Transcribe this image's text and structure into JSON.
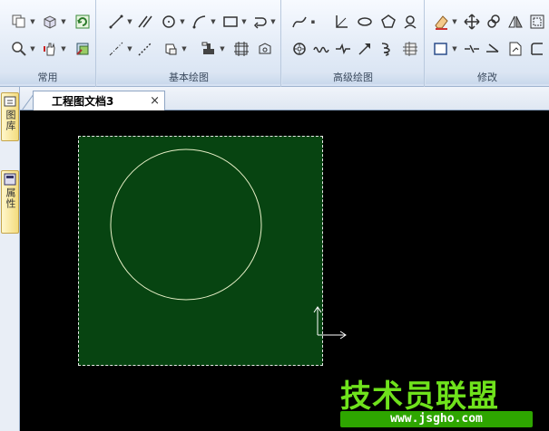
{
  "ribbon": {
    "groups": [
      {
        "label": "常用"
      },
      {
        "label": "基本绘图"
      },
      {
        "label": "高级绘图"
      },
      {
        "label": "修改"
      }
    ]
  },
  "left_dock": {
    "tabs": [
      {
        "label": "图库",
        "icon": "library-icon"
      },
      {
        "label": "属性",
        "icon": "properties-icon"
      }
    ]
  },
  "document": {
    "tab_title": "工程图文档3",
    "close_label": "×"
  },
  "canvas": {
    "background_color": "#000000",
    "drawing_area_color": "#074411",
    "shape_color": "#e8f0c8"
  },
  "watermark": {
    "main_text": "技术员联盟",
    "url_text": "www.jsgho.com"
  }
}
